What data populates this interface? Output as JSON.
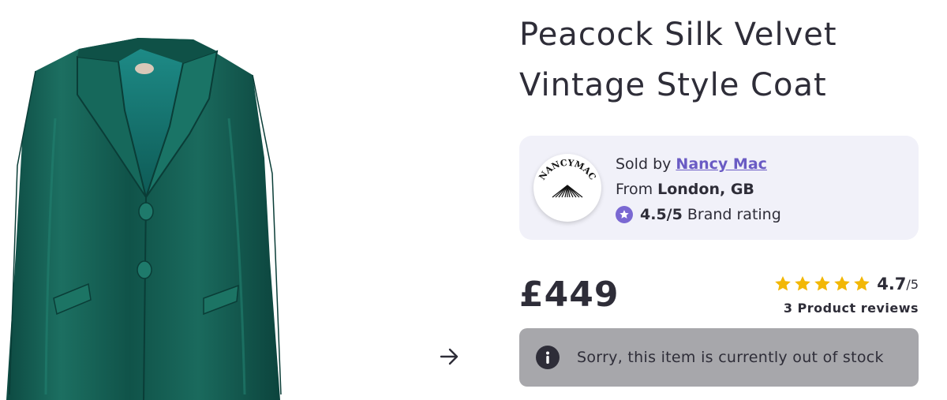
{
  "product": {
    "title_line1": "Peacock Silk Velvet",
    "title_line2": "Vintage Style Coat",
    "image_alt": "Peacock green silk velvet coat"
  },
  "seller": {
    "sold_by_label": "Sold by ",
    "name": "Nancy Mac",
    "from_label": "From ",
    "location": "London, GB",
    "brand_rating_value": "4.5/5",
    "brand_rating_label": " Brand rating",
    "logo_text": "NANCYMAC"
  },
  "pricing": {
    "price": "£449"
  },
  "reviews": {
    "rating": "4.7",
    "rating_max": "/5",
    "star_count": 5,
    "reviews_label": "3 Product reviews"
  },
  "stock": {
    "message": "Sorry, this item is currently out of stock"
  },
  "icons": {
    "next": "arrow-right-icon",
    "info": "info-icon",
    "rating_star": "star-icon"
  },
  "colors": {
    "coat": "#135a50",
    "seller_card_bg": "#f1f1f9",
    "seller_link": "#6a5bc4",
    "star": "#f2b705",
    "badge": "#7a68d2",
    "oos_bg": "#a7a7ab",
    "text": "#2e2d38"
  }
}
